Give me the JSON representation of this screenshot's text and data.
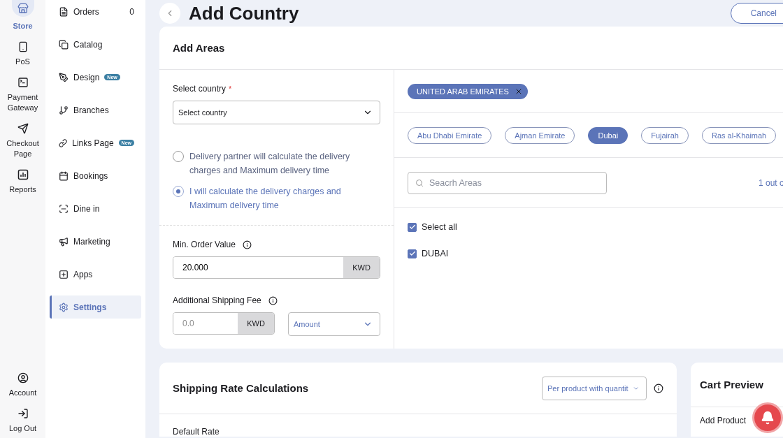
{
  "rail": {
    "top": [
      {
        "label": "Store",
        "selected": true
      },
      {
        "label": "PoS",
        "selected": false
      },
      {
        "label": "Payment Gateway",
        "selected": false
      },
      {
        "label": "Checkout Page",
        "selected": false
      },
      {
        "label": "Reports",
        "selected": false
      }
    ],
    "bottom": [
      {
        "label": "Account"
      },
      {
        "label": "Log Out"
      }
    ]
  },
  "nav": {
    "items": [
      {
        "label": "Orders",
        "count": "0",
        "selected": false
      },
      {
        "label": "Catalog",
        "selected": false
      },
      {
        "label": "Design",
        "badge": "New",
        "selected": false
      },
      {
        "label": "Branches",
        "selected": false
      },
      {
        "label": "Links Page",
        "badge": "New",
        "selected": false
      },
      {
        "label": "Bookings",
        "selected": false
      },
      {
        "label": "Dine in",
        "selected": false
      },
      {
        "label": "Marketing",
        "selected": false
      },
      {
        "label": "Apps",
        "selected": false
      },
      {
        "label": "Settings",
        "selected": true
      }
    ]
  },
  "page": {
    "title": "Add Country",
    "cancel": "Cancel"
  },
  "add_areas": {
    "title": "Add Areas",
    "country_label": "Select country",
    "required_mark": "*",
    "country_select": "Select country",
    "delivery_options": [
      {
        "label": "Delivery partner will calculate the delivery charges and Maximum delivery time",
        "selected": false
      },
      {
        "label": "I will calculate the delivery charges and Maximum delivery time",
        "selected": true
      }
    ],
    "min_order": {
      "label": "Min. Order Value",
      "value": "20.000",
      "currency": "KWD"
    },
    "shipping_fee": {
      "label": "Additional Shipping Fee",
      "placeholder": "0.0",
      "currency": "KWD",
      "type": "Amount"
    },
    "country_tag": "UNITED ARAB EMIRATES",
    "regions": [
      {
        "label": "Abu Dhabi Emirate",
        "selected": false
      },
      {
        "label": "Ajman Emirate",
        "selected": false
      },
      {
        "label": "Dubai",
        "selected": true
      },
      {
        "label": "Fujairah",
        "selected": false
      },
      {
        "label": "Ras al-Khaimah",
        "selected": false
      }
    ],
    "search": {
      "placeholder": "Seacrh Areas"
    },
    "count": "1 out o",
    "areas": [
      {
        "label": "Select all",
        "checked": true
      },
      {
        "label": "DUBAI",
        "checked": true
      }
    ]
  },
  "shipping_rate": {
    "title": "Shipping Rate Calculations",
    "method": "Per product with quantit",
    "row_label": "Default Rate"
  },
  "cart_preview": {
    "title": "Cart Preview",
    "add_product": "Add Product"
  }
}
